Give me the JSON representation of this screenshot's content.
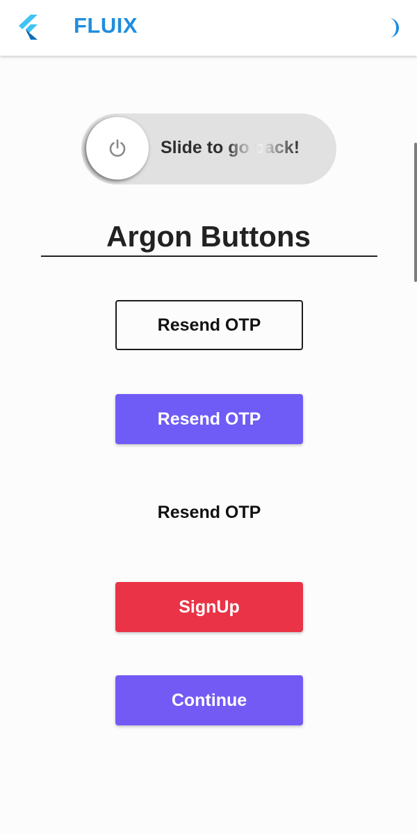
{
  "appbar": {
    "title": "FLUIX",
    "logo_icon": "flutter-logo-icon",
    "theme_icon": "crescent-moon-icon",
    "accent_color": "#1f8dde"
  },
  "slider": {
    "label": "Slide to go back!",
    "knob_icon": "power-icon"
  },
  "section": {
    "heading": "Argon Buttons"
  },
  "buttons": {
    "outline_label": "Resend OTP",
    "filled_label": "Resend OTP",
    "text_label": "Resend OTP",
    "signup_label": "SignUp",
    "continue_label": "Continue"
  },
  "colors": {
    "purple": "#6f5cf6",
    "red": "#ea3346",
    "continue_purple": "#745af5"
  }
}
